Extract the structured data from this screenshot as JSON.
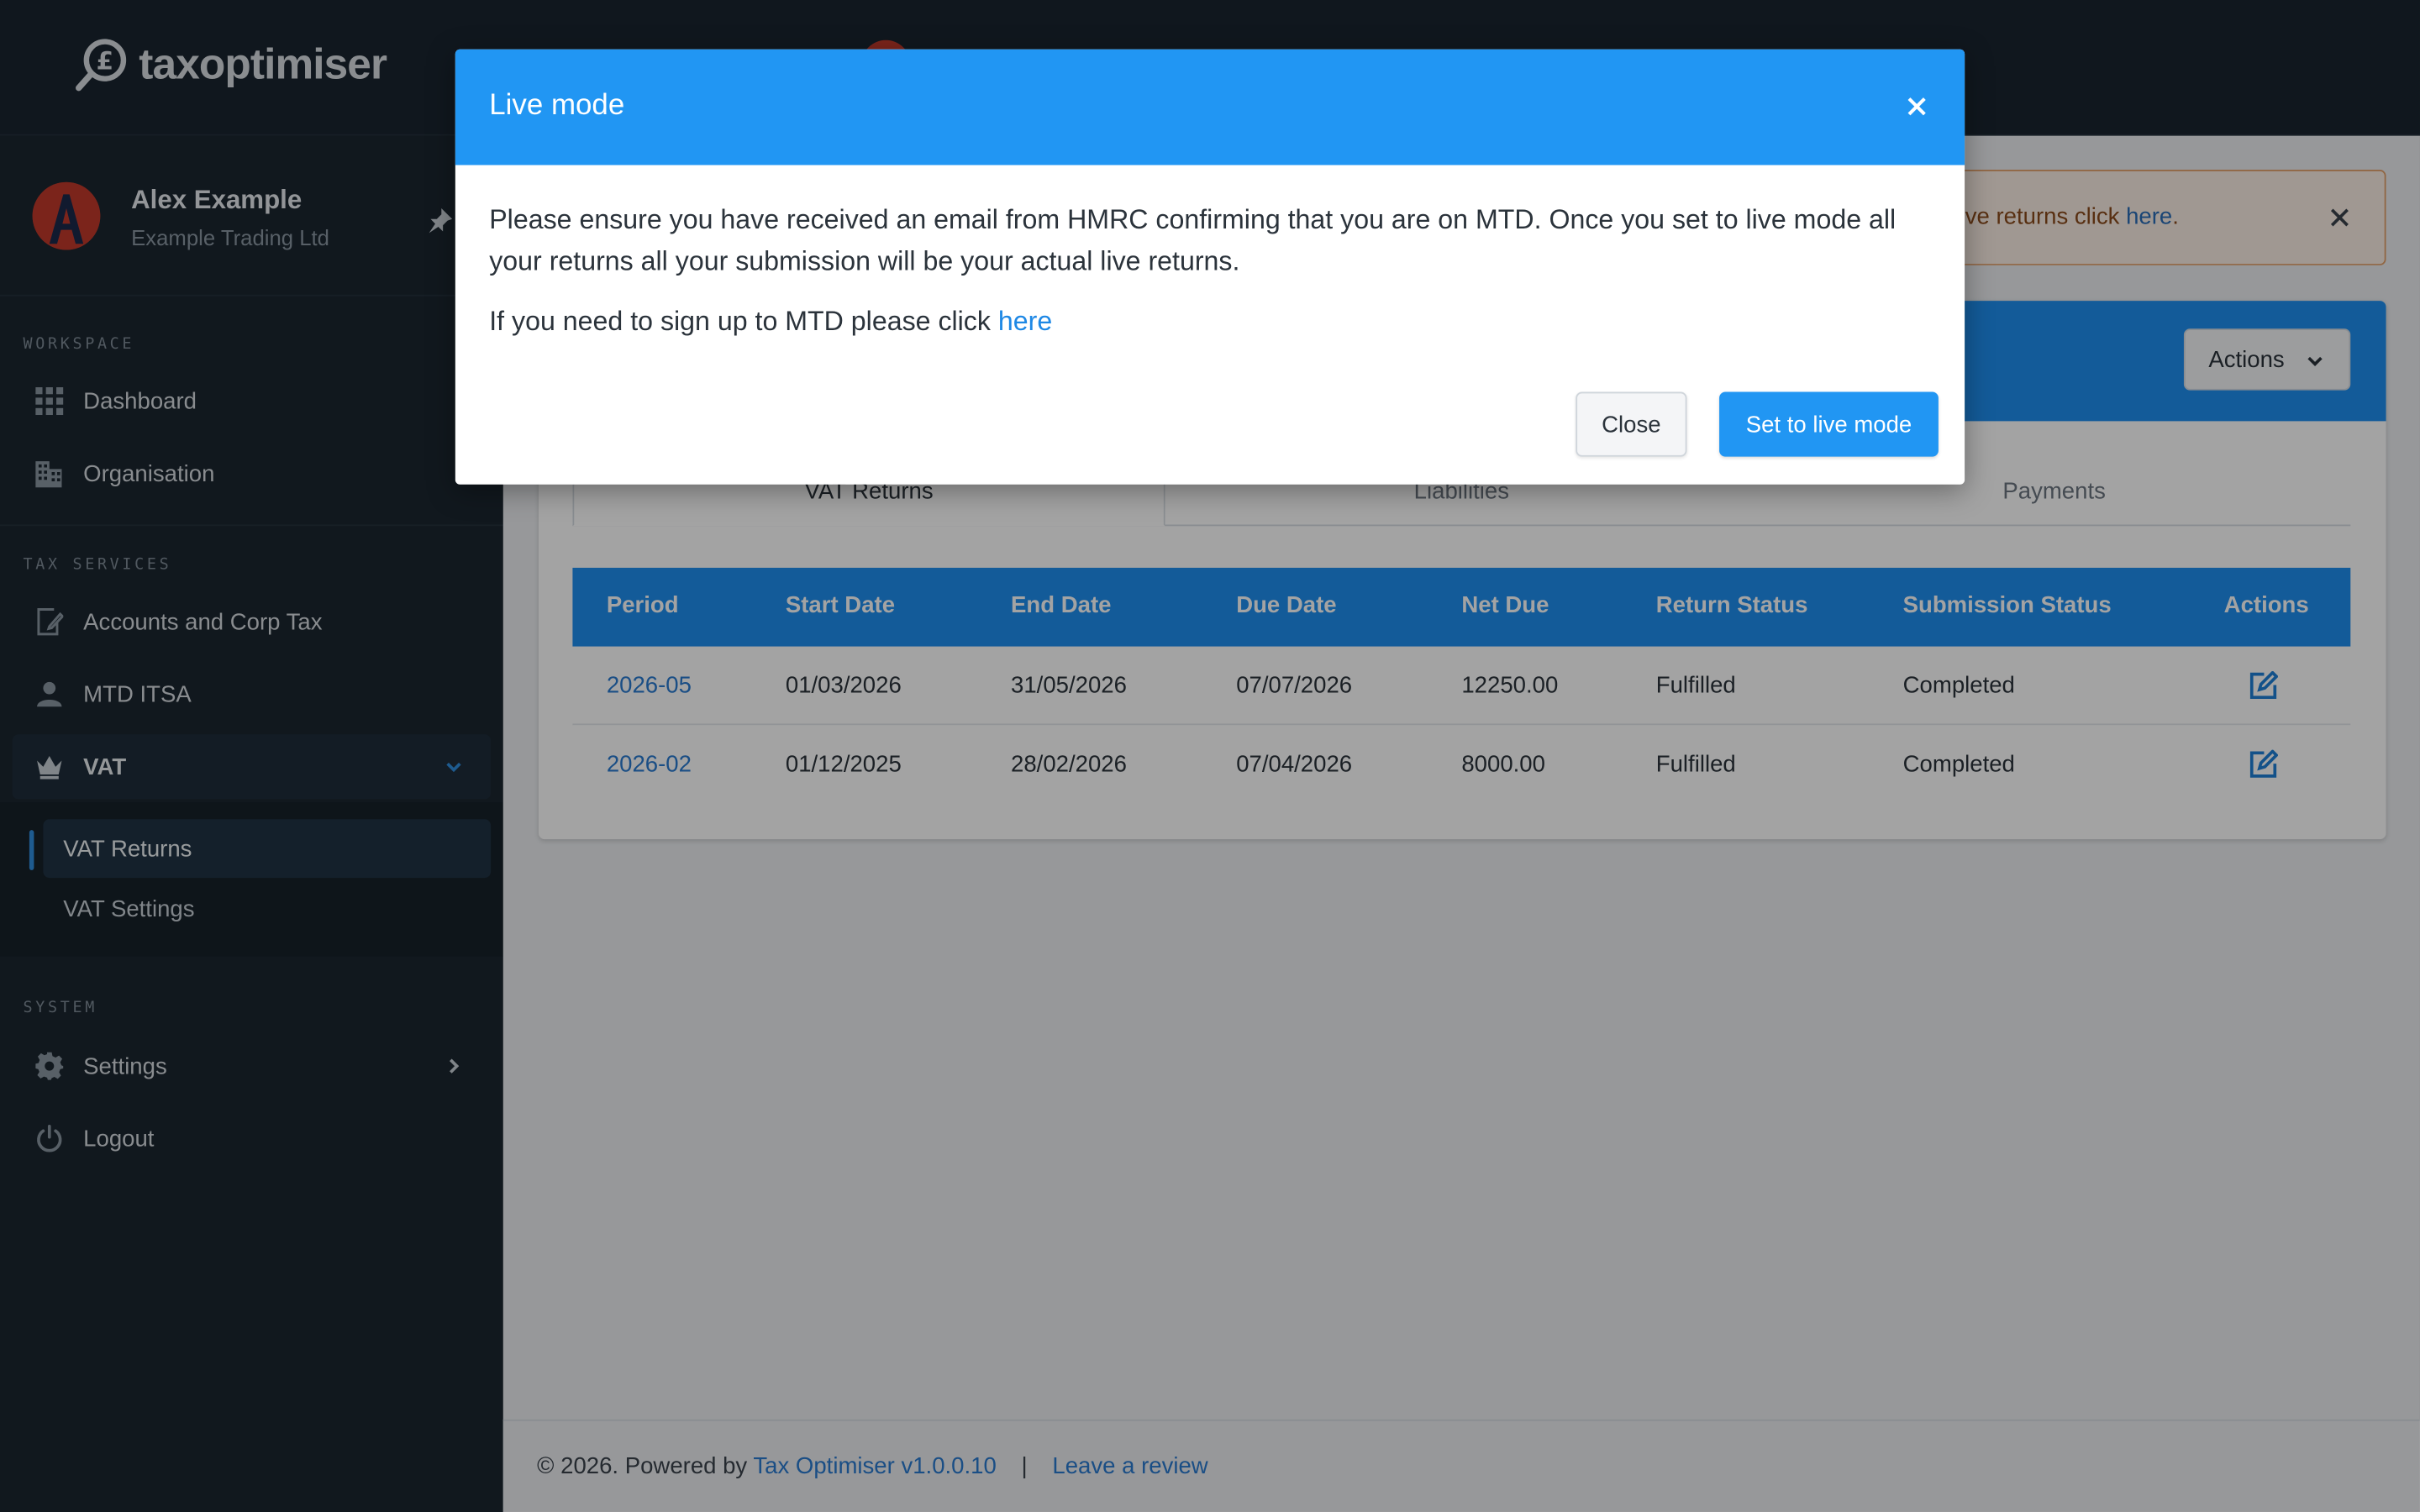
{
  "app": {
    "brand": "taxoptimiser"
  },
  "profile": {
    "name": "Alex Example",
    "organisation": "Example Trading Ltd",
    "avatar_letter": "A"
  },
  "sidebar": {
    "sections": [
      {
        "label": "WORKSPACE"
      },
      {
        "label": "TAX SERVICES"
      },
      {
        "label": "SYSTEM"
      }
    ],
    "items": [
      {
        "label": "Dashboard",
        "icon": "grid-icon"
      },
      {
        "label": "Organisation",
        "icon": "building-icon"
      },
      {
        "label": "Accounts and Corp Tax",
        "icon": "document-edit-icon"
      },
      {
        "label": "MTD ITSA",
        "icon": "person-icon"
      },
      {
        "label": "VAT",
        "icon": "crown-icon",
        "expanded": true
      },
      {
        "label": "Settings",
        "icon": "gear-icon"
      },
      {
        "label": "Logout",
        "icon": "power-icon"
      }
    ],
    "vat_submenu": [
      {
        "label": "VAT Returns",
        "active": true
      },
      {
        "label": "VAT Settings"
      }
    ]
  },
  "alert": {
    "text_prefix": "ive returns click ",
    "link": "here",
    "text_suffix": "."
  },
  "card": {
    "actions_label": "Actions",
    "tabs": [
      {
        "label": "VAT Returns",
        "active": true
      },
      {
        "label": "Liabilities"
      },
      {
        "label": "Payments"
      }
    ],
    "table": {
      "headers": [
        "Period",
        "Start Date",
        "End Date",
        "Due Date",
        "Net Due",
        "Return Status",
        "Submission Status",
        "Actions"
      ],
      "rows": [
        [
          "2026-05",
          "01/03/2026",
          "31/05/2026",
          "07/07/2026",
          "12250.00",
          "Fulfilled",
          "Completed"
        ],
        [
          "2026-02",
          "01/12/2025",
          "28/02/2026",
          "07/04/2026",
          "8000.00",
          "Fulfilled",
          "Completed"
        ]
      ]
    }
  },
  "footer": {
    "copyright": "© 2026. Powered by ",
    "product_link": "Tax Optimiser v1.0.0.10",
    "separator": "|",
    "review_link": "Leave a review"
  },
  "modal": {
    "title": "Live mode",
    "paragraph1": "Please ensure you have received an email from HMRC confirming that you are on MTD. Once you set to live mode all your returns all your submission will be your actual live returns.",
    "paragraph2_prefix": "If you need to sign up to MTD please click ",
    "paragraph2_link": "here",
    "close_label": "Close",
    "confirm_label": "Set to live mode"
  },
  "colors": {
    "accent": "#2196f3",
    "sidebar_bg": "#1b2630",
    "header_blue": "#1f8ff0",
    "link": "#2a7ad0"
  }
}
